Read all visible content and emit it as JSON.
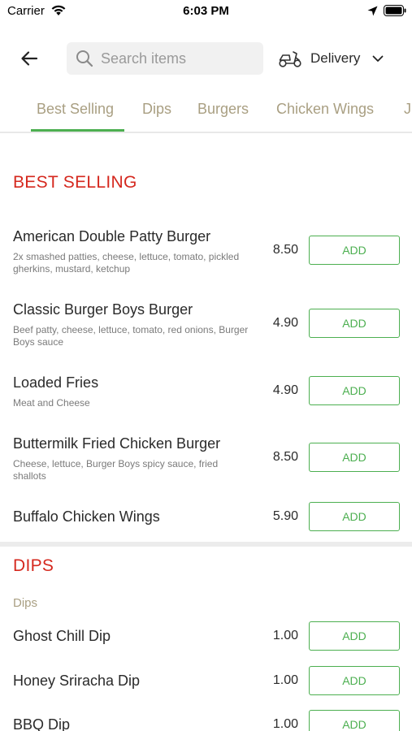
{
  "status_bar": {
    "carrier": "Carrier",
    "time": "6:03 PM"
  },
  "header": {
    "search_placeholder": "Search items",
    "delivery_label": "Delivery",
    "icons": [
      "back-arrow-icon",
      "search-icon",
      "scooter-icon",
      "chevron-down-icon"
    ]
  },
  "tabs": [
    {
      "label": "Best Selling",
      "active": true
    },
    {
      "label": "Dips"
    },
    {
      "label": "Burgers"
    },
    {
      "label": "Chicken Wings"
    },
    {
      "label": "J"
    }
  ],
  "sections": {
    "best_selling": {
      "title": "BEST SELLING",
      "items": [
        {
          "name": "American Double Patty Burger",
          "description": "2x smashed patties, cheese, lettuce, tomato, pickled gherkins, mustard, ketchup",
          "price": "8.50",
          "button": "ADD"
        },
        {
          "name": "Classic Burger Boys Burger",
          "description": "Beef patty, cheese, lettuce, tomato, red onions, Burger Boys sauce",
          "price": "4.90",
          "button": "ADD"
        },
        {
          "name": "Loaded Fries",
          "description": "Meat and Cheese",
          "price": "4.90",
          "button": "ADD"
        },
        {
          "name": "Buttermilk Fried Chicken Burger",
          "description": "Cheese, lettuce, Burger Boys spicy sauce, fried shallots",
          "price": "8.50",
          "button": "ADD"
        },
        {
          "name": "Buffalo Chicken Wings",
          "description": "",
          "price": "5.90",
          "button": "ADD"
        }
      ]
    },
    "dips": {
      "title": "DIPS",
      "subcategory": "Dips",
      "items": [
        {
          "name": "Ghost Chill Dip",
          "price": "1.00",
          "button": "ADD"
        },
        {
          "name": "Honey Sriracha Dip",
          "price": "1.00",
          "button": "ADD"
        },
        {
          "name": "BBQ Dip",
          "price": "1.00",
          "button": "ADD"
        }
      ]
    }
  },
  "colors": {
    "section_title": "#d5281e",
    "accent_green": "#4caf50",
    "tab_text": "#a99f82"
  }
}
